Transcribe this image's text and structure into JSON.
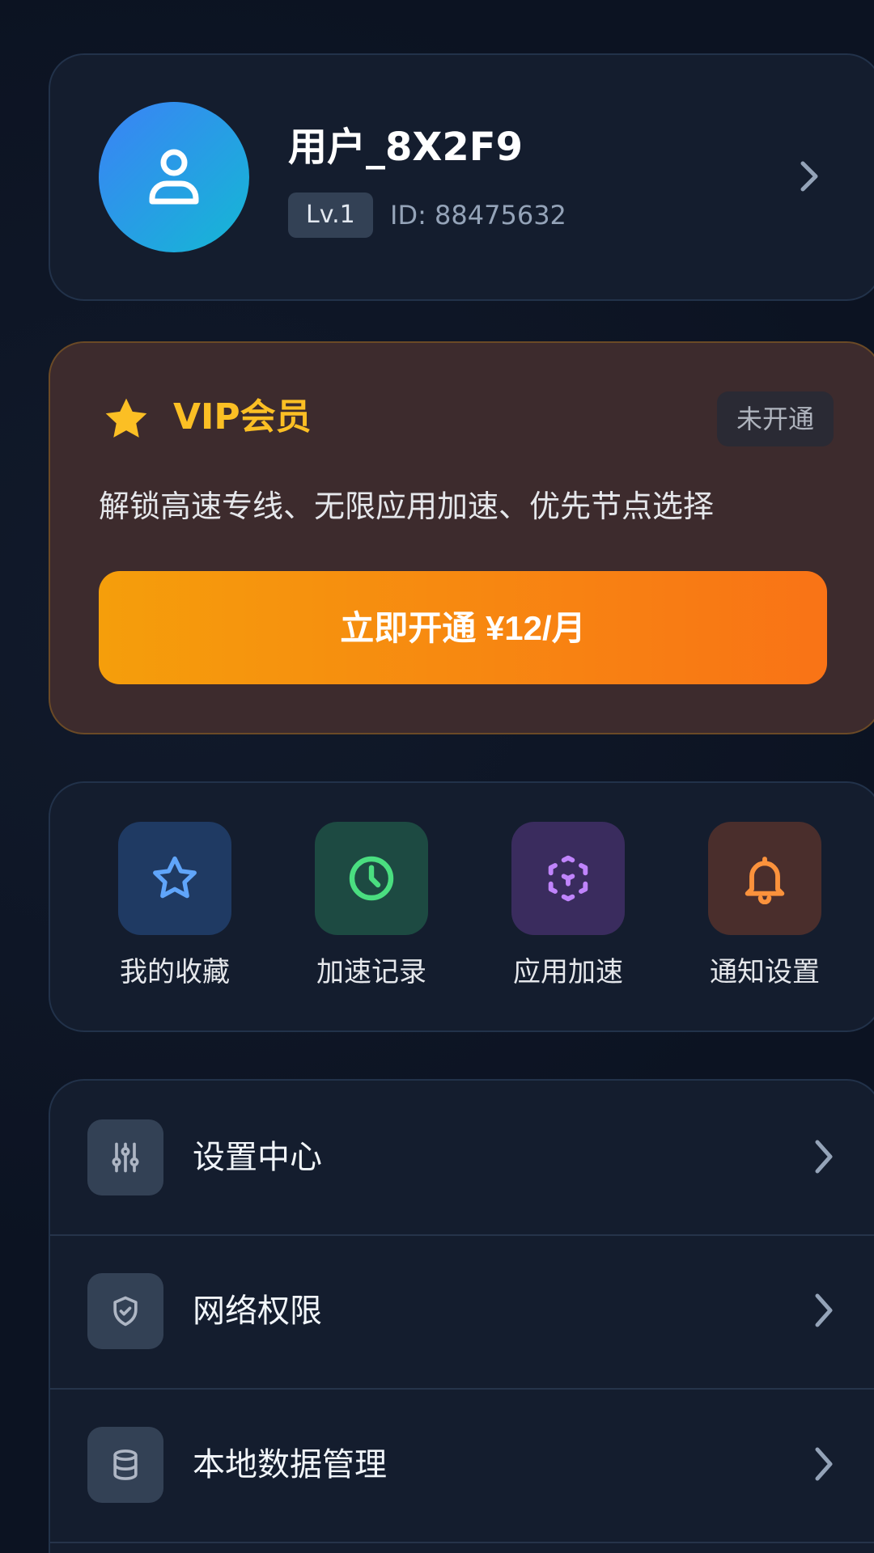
{
  "profile": {
    "username": "用户_8X2F9",
    "level": "Lv.1",
    "user_id": "ID: 88475632",
    "avatar_icon": "user-icon"
  },
  "vip": {
    "title": "VIP会员",
    "status": "未开通",
    "description": "解锁高速专线、无限应用加速、优先节点选择",
    "button_label": "立即开通 ¥12/月",
    "accent_color": "#fbbf24",
    "button_gradient": [
      "#f59e0b",
      "#f97316"
    ]
  },
  "quick_actions": [
    {
      "label": "我的收藏",
      "icon": "star-outline-icon",
      "color": "#60a5fa",
      "bg": "#1f3a63"
    },
    {
      "label": "加速记录",
      "icon": "clock-icon",
      "color": "#4ade80",
      "bg": "#1d4a42"
    },
    {
      "label": "应用加速",
      "icon": "cube-icon",
      "color": "#c084fc",
      "bg": "#3a2c5e"
    },
    {
      "label": "通知设置",
      "icon": "bell-icon",
      "color": "#fb923c",
      "bg": "#4a2e2c"
    }
  ],
  "menu": [
    {
      "label": "设置中心",
      "icon": "sliders-icon"
    },
    {
      "label": "网络权限",
      "icon": "shield-check-icon"
    },
    {
      "label": "本地数据管理",
      "icon": "database-icon"
    }
  ]
}
